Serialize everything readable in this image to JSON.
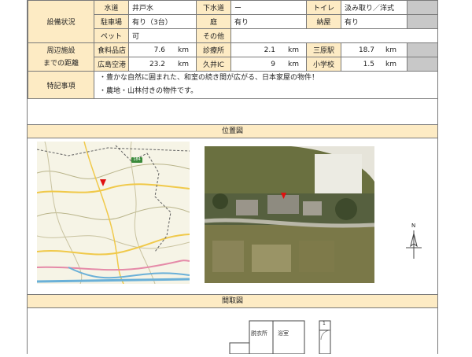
{
  "facilities": {
    "section_label": "設備状況",
    "rows": [
      [
        {
          "l": "水道",
          "v": "井戸水"
        },
        {
          "l": "下水道",
          "v": "ー"
        },
        {
          "l": "トイレ",
          "v": "汲み取り／洋式"
        }
      ],
      [
        {
          "l": "駐車場",
          "v": "有り（3台）"
        },
        {
          "l": "庭",
          "v": "有り"
        },
        {
          "l": "納屋",
          "v": "有り"
        }
      ],
      [
        {
          "l": "ペット",
          "v": "可"
        },
        {
          "l": "その他",
          "v": ""
        }
      ]
    ]
  },
  "distances": {
    "section_label_1": "周辺施設",
    "section_label_2": "までの距離",
    "unit": "km",
    "rows": [
      [
        {
          "l": "食料品店",
          "v": "7.6"
        },
        {
          "l": "診療所",
          "v": "2.1"
        },
        {
          "l": "三原駅",
          "v": "18.7"
        }
      ],
      [
        {
          "l": "広島空港",
          "v": "23.2"
        },
        {
          "l": "久井IC",
          "v": "9"
        },
        {
          "l": "小学校",
          "v": "1.5"
        }
      ]
    ]
  },
  "special": {
    "label": "特記事項",
    "lines": [
      "・豊かな自然に囲まれた、和室の続き間が広がる、日本家屋の物件！",
      "・農地・山林付きの物件です。"
    ]
  },
  "location": {
    "label": "位置図",
    "road_badge": "184"
  },
  "floor_plan": {
    "label": "間取図",
    "rooms": [
      "脱衣所",
      "浴室"
    ],
    "small_mark": "1"
  },
  "compass": {
    "north": "N"
  },
  "colors": {
    "header_bg": "#fdebc4",
    "border": "#7a7a7a",
    "marker": "#e01010",
    "placeholder": "#c8c8c8"
  }
}
